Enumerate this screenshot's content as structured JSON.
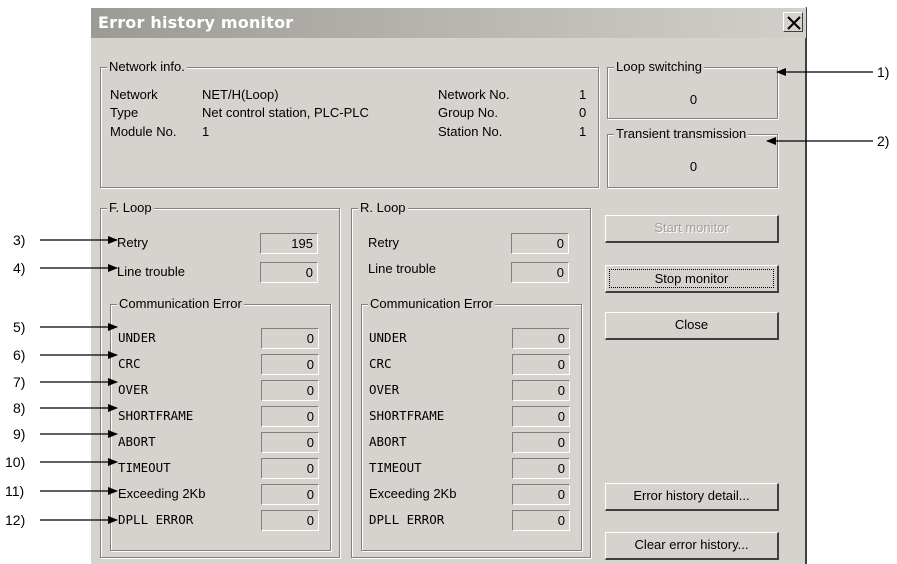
{
  "window": {
    "title": "Error history monitor"
  },
  "network_info": {
    "group_label": "Network info.",
    "network_label": "Network",
    "network_value": "NET/H(Loop)",
    "type_label": "Type",
    "type_value": "Net control station, PLC-PLC",
    "module_label": "Module No.",
    "module_value": "1",
    "network_no_label": "Network No.",
    "network_no_value": "1",
    "group_no_label": "Group No.",
    "group_no_value": "0",
    "station_no_label": "Station No.",
    "station_no_value": "1"
  },
  "loop_switching": {
    "label": "Loop switching",
    "value": "0"
  },
  "transient_transmission": {
    "label": "Transient transmission",
    "value": "0"
  },
  "f_loop": {
    "label": "F. Loop",
    "retry_label": "Retry",
    "retry_value": "195",
    "line_trouble_label": "Line trouble",
    "line_trouble_value": "0",
    "comm_error_label": "Communication Error",
    "errors": [
      {
        "label": "UNDER",
        "value": "0"
      },
      {
        "label": "CRC",
        "value": "0"
      },
      {
        "label": "OVER",
        "value": "0"
      },
      {
        "label": "SHORTFRAME",
        "value": "0"
      },
      {
        "label": "ABORT",
        "value": "0"
      },
      {
        "label": "TIMEOUT",
        "value": "0"
      },
      {
        "label": "Exceeding 2Kb",
        "value": "0"
      },
      {
        "label": "DPLL ERROR",
        "value": "0"
      }
    ]
  },
  "r_loop": {
    "label": "R. Loop",
    "retry_label": "Retry",
    "retry_value": "0",
    "line_trouble_label": "Line trouble",
    "line_trouble_value": "0",
    "comm_error_label": "Communication Error",
    "errors": [
      {
        "label": "UNDER",
        "value": "0"
      },
      {
        "label": "CRC",
        "value": "0"
      },
      {
        "label": "OVER",
        "value": "0"
      },
      {
        "label": "SHORTFRAME",
        "value": "0"
      },
      {
        "label": "ABORT",
        "value": "0"
      },
      {
        "label": "TIMEOUT",
        "value": "0"
      },
      {
        "label": "Exceeding 2Kb",
        "value": "0"
      },
      {
        "label": "DPLL ERROR",
        "value": "0"
      }
    ]
  },
  "buttons": {
    "start_monitor": "Start monitor",
    "stop_monitor": "Stop monitor",
    "close": "Close",
    "error_history_detail": "Error history detail...",
    "clear_error_history": "Clear error history..."
  },
  "callouts": [
    "1)",
    "2)",
    "3)",
    "4)",
    "5)",
    "6)",
    "7)",
    "8)",
    "9)",
    "10)",
    "11)",
    "12)"
  ],
  "icons": {
    "close": "close-icon"
  }
}
